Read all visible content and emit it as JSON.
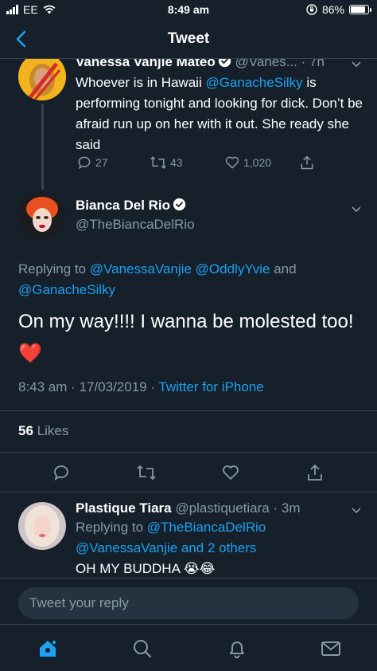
{
  "status_bar": {
    "carrier": "EE",
    "time": "8:49 am",
    "battery": "86%",
    "battery_level": 0.86
  },
  "header": {
    "title": "Tweet"
  },
  "parent_tweet": {
    "name": "Vanessa Vanjie Mateo",
    "handle": "@Vanes...",
    "time": "· 7h",
    "text_pre": "Whoever is in Hawaii ",
    "mention": "@GanacheSilky",
    "text_post": " is performing tonight and looking for dick. Don’t be afraid run up on her with it out. She ready she said",
    "replies": "27",
    "retweets": "43",
    "likes": "1,020"
  },
  "main_tweet": {
    "name": "Bianca Del Rio",
    "handle": "@TheBiancaDelRio",
    "replying_prefix": "Replying to ",
    "replying_user1": "@VanessaVanjie",
    "replying_user2": "@OddlyYvie",
    "replying_and": " and",
    "replying_user3": "@GanacheSilky",
    "text": "On my way!!!! I wanna be molested too!",
    "emoji": "❤️",
    "timestamp": "8:43 am · 17/03/2019 · ",
    "source": "Twitter for iPhone",
    "likes_count": "56",
    "likes_label": "Likes"
  },
  "reply_tweet": {
    "name": "Plastique Tiara",
    "handle": "@plastiquetiara",
    "time": "· 3m",
    "replying_prefix": "Replying to ",
    "replying_user1": "@TheBiancaDelRio",
    "replying_user2": "@VanessaVanjie",
    "replying_rest": " and 2 others",
    "text": "OH MY BUDDHA 😭😂"
  },
  "reply_bar": {
    "placeholder": "Tweet your reply"
  },
  "tab_bar": {
    "items": [
      "home-icon",
      "search-icon",
      "notifications-icon",
      "messages-icon"
    ]
  },
  "colors": {
    "background": "#15202b",
    "accent": "#1da1f2",
    "secondary_text": "#8899a6",
    "divider": "#38444d"
  }
}
